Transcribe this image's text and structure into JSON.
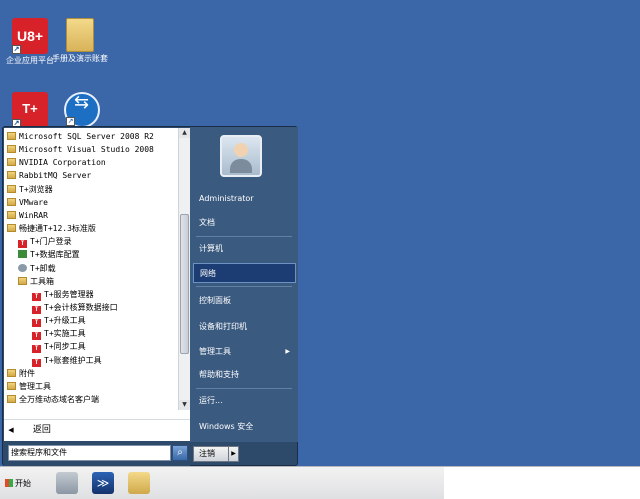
{
  "desktop": {
    "icons": [
      {
        "label": "企业应用平台",
        "icon": "u8-plus-icon",
        "badge": "U8+"
      },
      {
        "label": "手册及演示账套",
        "icon": "folder-icon"
      },
      {
        "label": "",
        "icon": "tplus-icon",
        "badge": "T+"
      },
      {
        "label": "",
        "icon": "teamviewer-icon"
      }
    ]
  },
  "start_menu": {
    "programs": [
      {
        "label": "Microsoft SQL Server 2008 R2",
        "icon": "folder-icon",
        "indent": 0
      },
      {
        "label": "Microsoft Visual Studio 2008",
        "icon": "folder-icon",
        "indent": 0
      },
      {
        "label": "NVIDIA Corporation",
        "icon": "folder-icon",
        "indent": 0
      },
      {
        "label": "RabbitMQ Server",
        "icon": "folder-icon",
        "indent": 0
      },
      {
        "label": "T+浏览器",
        "icon": "folder-icon",
        "indent": 0
      },
      {
        "label": "VMware",
        "icon": "folder-icon",
        "indent": 0
      },
      {
        "label": "WinRAR",
        "icon": "folder-icon",
        "indent": 0
      },
      {
        "label": "畅捷通T+12.3标准版",
        "icon": "folder-icon",
        "indent": 0
      },
      {
        "label": "T+门户登录",
        "icon": "tplus-icon",
        "indent": 1
      },
      {
        "label": "T+数据库配置",
        "icon": "database-icon",
        "indent": 1
      },
      {
        "label": "T+卸载",
        "icon": "uninstall-icon",
        "indent": 1
      },
      {
        "label": "工具箱",
        "icon": "folder-icon",
        "indent": 1
      },
      {
        "label": "T+服务管理器",
        "icon": "tplus-icon",
        "indent": 2
      },
      {
        "label": "T+会计核算数据接口",
        "icon": "tplus-icon",
        "indent": 2
      },
      {
        "label": "T+升级工具",
        "icon": "tplus-icon",
        "indent": 2
      },
      {
        "label": "T+实施工具",
        "icon": "tplus-icon",
        "indent": 2
      },
      {
        "label": "T+同步工具",
        "icon": "tplus-icon",
        "indent": 2
      },
      {
        "label": "T+账套维护工具",
        "icon": "tplus-icon",
        "indent": 2
      },
      {
        "label": "附件",
        "icon": "folder-icon",
        "indent": 0
      },
      {
        "label": "管理工具",
        "icon": "folder-icon",
        "indent": 0
      },
      {
        "label": "全万维动态域名客户端",
        "icon": "folder-icon",
        "indent": 0
      }
    ],
    "back_label": "返回",
    "search_placeholder": "搜索程序和文件",
    "right_items": [
      {
        "label": "Administrator",
        "active": false,
        "arrow": false
      },
      {
        "label": "文档",
        "active": false,
        "arrow": false
      },
      {
        "label": "计算机",
        "active": false,
        "arrow": false
      },
      {
        "label": "网络",
        "active": true,
        "arrow": false
      },
      {
        "label": "控制面板",
        "active": false,
        "arrow": false
      },
      {
        "label": "设备和打印机",
        "active": false,
        "arrow": false
      },
      {
        "label": "管理工具",
        "active": false,
        "arrow": true
      },
      {
        "label": "帮助和支持",
        "active": false,
        "arrow": false
      },
      {
        "label": "运行...",
        "active": false,
        "arrow": false
      },
      {
        "label": "Windows 安全",
        "active": false,
        "arrow": false
      }
    ],
    "shutdown_label": "注销"
  },
  "taskbar": {
    "start_label": "开始"
  },
  "colors": {
    "highlight_border": "#d22a2a",
    "active_item": "#1b3d73"
  }
}
